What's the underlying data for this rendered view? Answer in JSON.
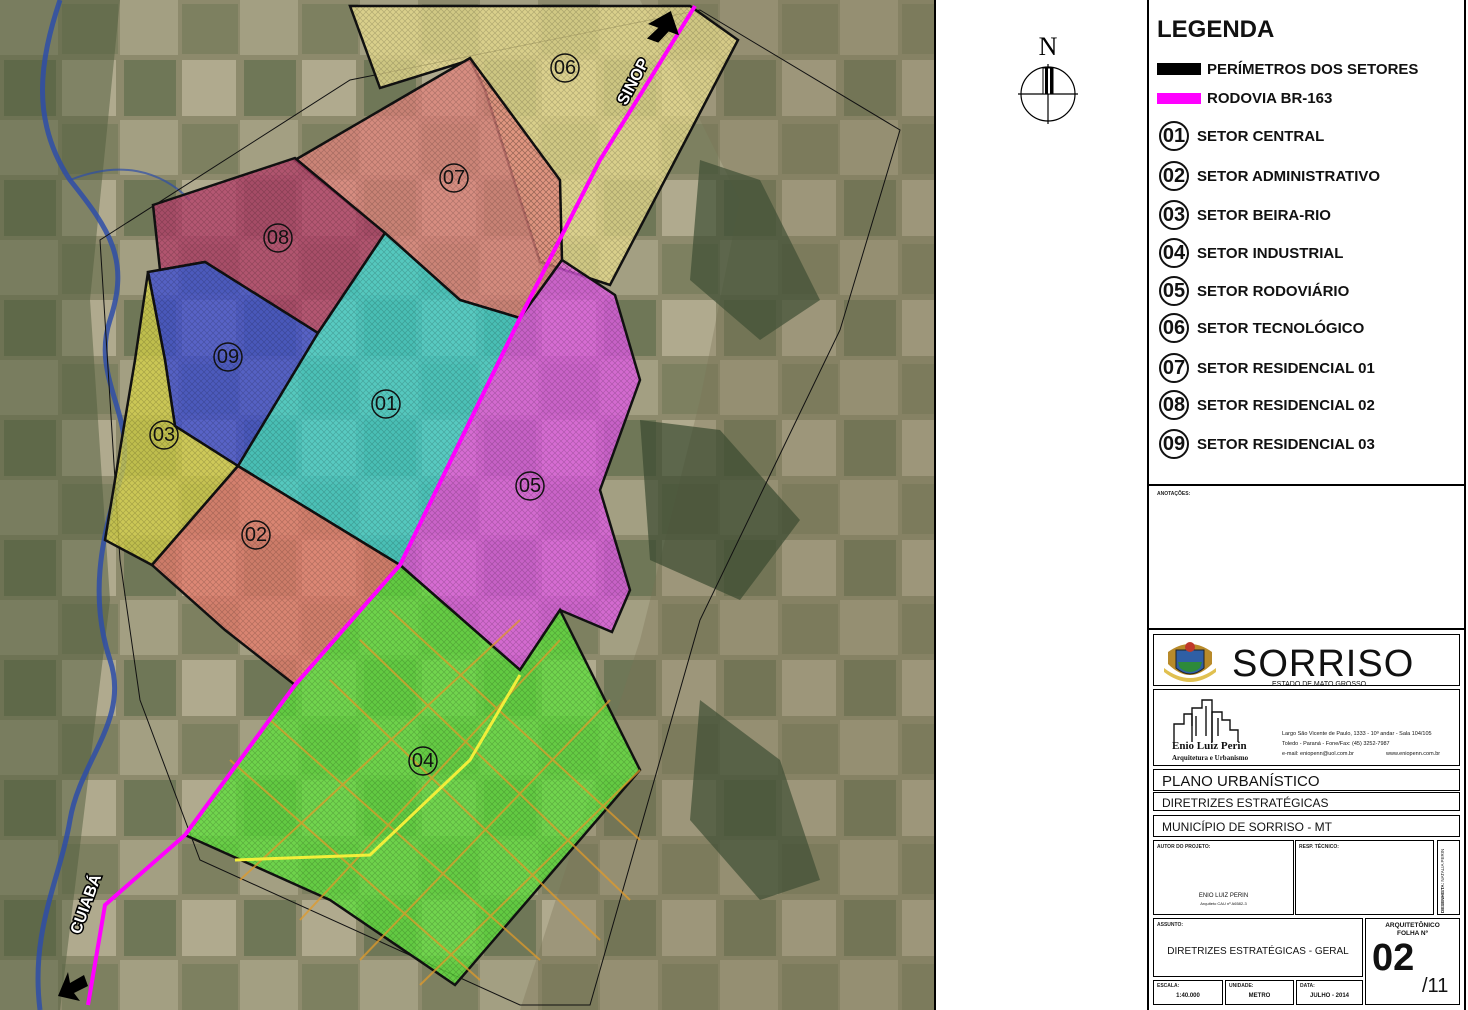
{
  "legend": {
    "title": "LEGENDA",
    "perimetros_label": "PERÍMETROS DOS SETORES",
    "perimetros_color": "#000000",
    "rodovia_label": "RODOVIA BR-163",
    "rodovia_color": "#ff00ff",
    "sectors": [
      {
        "num": "01",
        "label": "SETOR CENTRAL"
      },
      {
        "num": "02",
        "label": "SETOR ADMINISTRATIVO"
      },
      {
        "num": "03",
        "label": "SETOR BEIRA-RIO"
      },
      {
        "num": "04",
        "label": "SETOR INDUSTRIAL"
      },
      {
        "num": "05",
        "label": "SETOR RODOVIÁRIO"
      },
      {
        "num": "06",
        "label": "SETOR TECNOLÓGICO"
      },
      {
        "num": "07",
        "label": "SETOR RESIDENCIAL 01"
      },
      {
        "num": "08",
        "label": "SETOR RESIDENCIAL 02"
      },
      {
        "num": "09",
        "label": "SETOR RESIDENCIAL 03"
      }
    ]
  },
  "compass": {
    "north": "N"
  },
  "map": {
    "route_north": "SINOP",
    "route_south": "CUIABÁ",
    "sector_colors": {
      "01": "#3fd4d0",
      "02": "#e87d6e",
      "03": "#d6d24a",
      "04": "#5fe23c",
      "05": "#e05be6",
      "06": "#e8dd8e",
      "07": "#e2857e",
      "08": "#b5406a",
      "09": "#3f4fd6"
    },
    "sector_labels": {
      "01": "01",
      "02": "02",
      "03": "03",
      "04": "04",
      "05": "05",
      "06": "06",
      "07": "07",
      "08": "08",
      "09": "09"
    }
  },
  "title_block": {
    "annotations_label": "ANOTAÇÕES:",
    "city": "SORRISO",
    "state": "ESTADO DE MATO GROSSO",
    "firm_name": "Enio Luiz Perin",
    "firm_sub": "Arquitetura e Urbanismo",
    "address_1": "Largo São Vicente de Paulo, 1333 - 10º andar - Sala 104/105",
    "address_2": "Toledo - Paraná - Fone/Fax: (45) 3252-7987",
    "email": "e-mail: eniopenn@uol.com.br",
    "website": "www.eniopenn.com.br",
    "plan": "PLANO URBANÍSTICO",
    "plan_sub": "DIRETRIZES ESTRATÉGICAS",
    "municipality": "MUNICÍPIO DE SORRISO - MT",
    "author_label": "AUTOR DO PROJETO:",
    "author_name": "ENIO LUIZ PERIN",
    "author_reg": "Arquiteto CAU nº A6582-3",
    "tech_label": "RESP. TÉCNICO:",
    "drawn_label": "DESENHISTA:",
    "drawn_name": "NATALIA PERIN",
    "subject_label": "ASSUNTO:",
    "subject": "DIRETRIZES ESTRATÉGICAS - GERAL",
    "sheet_type": "ARQUITETÔNICO",
    "sheet_label": "FOLHA Nº",
    "sheet_num": "02",
    "sheet_total": "/11",
    "scale_label": "ESCALA:",
    "scale": "1:40.000",
    "unit_label": "UNIDADE:",
    "unit": "METRO",
    "date_label": "DATA:",
    "date": "JULHO - 2014"
  }
}
